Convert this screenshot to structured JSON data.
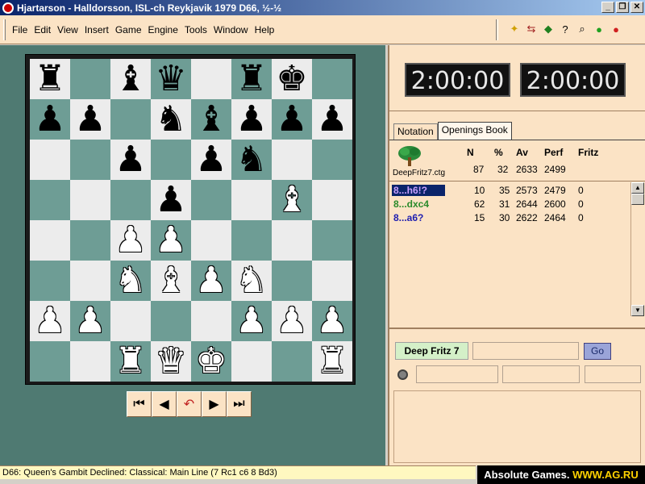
{
  "window": {
    "title": "Hjartarson - Halldorsson, ISL-ch Reykjavik 1979  D66, ½-½",
    "buttons": [
      "_",
      "❐",
      "✕"
    ]
  },
  "menu": {
    "items": [
      "File",
      "Edit",
      "View",
      "Insert",
      "Game",
      "Engine",
      "Tools",
      "Window",
      "Help"
    ]
  },
  "toolbar": {
    "icons": [
      "new-game-icon",
      "flip-board-icon",
      "engine-icon",
      "hint-icon",
      "analysis-icon",
      "start-engine-icon",
      "stop-engine-icon"
    ]
  },
  "board": {
    "colors": {
      "light": "#ececec",
      "dark": "#6e9d95",
      "frame": "#4f7a72"
    },
    "ranks": [
      [
        "br",
        "",
        "bb",
        "bq",
        "",
        "br",
        "bk",
        ""
      ],
      [
        "bp",
        "bp",
        "",
        "bn",
        "bb",
        "bp",
        "bp",
        "bp"
      ],
      [
        "",
        "",
        "bp",
        "",
        "bp",
        "bn",
        "",
        ""
      ],
      [
        "",
        "",
        "",
        "bp",
        "",
        "",
        "wb",
        ""
      ],
      [
        "",
        "",
        "wp",
        "wp",
        "",
        "",
        "",
        ""
      ],
      [
        "",
        "",
        "wn",
        "wb",
        "wp",
        "wn",
        "",
        ""
      ],
      [
        "wp",
        "wp",
        "",
        "",
        "",
        "wp",
        "wp",
        "wp"
      ],
      [
        "",
        "",
        "wr",
        "wq",
        "wk",
        "",
        "",
        "wr"
      ]
    ]
  },
  "nav": {
    "buttons": [
      {
        "name": "first-move-button",
        "glyph": "⏮"
      },
      {
        "name": "prev-move-button",
        "glyph": "◀"
      },
      {
        "name": "takeback-button",
        "glyph": "↶"
      },
      {
        "name": "next-move-button",
        "glyph": "▶"
      },
      {
        "name": "last-move-button",
        "glyph": "⏭"
      }
    ]
  },
  "clocks": {
    "white": "2:00:00",
    "black": "2:00:00"
  },
  "tabs": [
    {
      "label": "Notation",
      "active": false
    },
    {
      "label": "Openings Book",
      "active": true
    }
  ],
  "book": {
    "file": "DeepFritz7.ctg",
    "headers": {
      "n": "N",
      "pct": "%",
      "av": "Av",
      "perf": "Perf",
      "fritz": "Fritz"
    },
    "summary": {
      "n": "87",
      "pct": "32",
      "av": "2633",
      "perf": "2499"
    },
    "moves": [
      {
        "move": "8...h6!?",
        "n": "10",
        "pct": "35",
        "av": "2573",
        "perf": "2479",
        "fritz": "0"
      },
      {
        "move": "8...dxc4",
        "n": "62",
        "pct": "31",
        "av": "2644",
        "perf": "2600",
        "fritz": "0"
      },
      {
        "move": "8...a6?",
        "n": "15",
        "pct": "30",
        "av": "2622",
        "perf": "2464",
        "fritz": "0"
      }
    ]
  },
  "engine": {
    "name": "Deep Fritz 7",
    "go": "Go"
  },
  "status": "D66: Queen's Gambit Declined: Classical: Main Line (7 Rc1 c6 8 Bd3)",
  "brand": {
    "prefix": "Absolute Games. ",
    "highlight": "WWW.AG.RU"
  }
}
